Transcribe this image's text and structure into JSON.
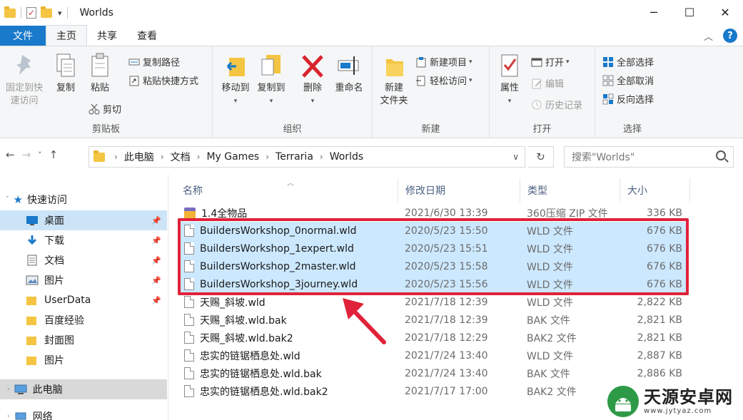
{
  "window": {
    "title": "Worlds",
    "minimize": "─",
    "maximize": "☐",
    "close": "✕"
  },
  "tabs": [
    {
      "label": "文件"
    },
    {
      "label": "主页"
    },
    {
      "label": "共享"
    },
    {
      "label": "查看"
    }
  ],
  "ribbon": {
    "clipboard": {
      "label": "剪贴板",
      "pin_quick_line1": "固定到快",
      "pin_quick_line2": "速访问",
      "copy": "复制",
      "paste": "粘贴",
      "copy_path": "复制路径",
      "paste_shortcut": "粘贴快捷方式",
      "cut": "剪切"
    },
    "organize": {
      "label": "组织",
      "move_to": "移动到",
      "copy_to": "复制到",
      "delete": "删除",
      "rename": "重命名"
    },
    "new": {
      "label": "新建",
      "new_folder_line1": "新建",
      "new_folder_line2": "文件夹",
      "new_item": "新建项目",
      "easy_access": "轻松访问"
    },
    "open": {
      "label": "打开",
      "properties": "属性",
      "open": "打开",
      "edit": "编辑",
      "history": "历史记录"
    },
    "select": {
      "label": "选择",
      "select_all": "全部选择",
      "select_none": "全部取消",
      "invert": "反向选择"
    }
  },
  "address": {
    "crumbs": [
      "此电脑",
      "文档",
      "My Games",
      "Terraria",
      "Worlds"
    ],
    "search_placeholder": "搜索\"Worlds\""
  },
  "sidebar": {
    "quick_access": "快速访问",
    "items": [
      {
        "label": "桌面"
      },
      {
        "label": "下载"
      },
      {
        "label": "文档"
      },
      {
        "label": "图片"
      },
      {
        "label": "UserData"
      },
      {
        "label": "百度经验"
      },
      {
        "label": "封面图"
      },
      {
        "label": "图片"
      }
    ],
    "this_pc": "此电脑",
    "network": "网络"
  },
  "columns": {
    "name": "名称",
    "date": "修改日期",
    "type": "类型",
    "size": "大小"
  },
  "files": [
    {
      "name": "1.4全物品",
      "date": "2021/6/30 13:39",
      "type": "360压缩 ZIP 文件",
      "size": "336 KB"
    },
    {
      "name": "BuildersWorkshop_0normal.wld",
      "date": "2020/5/23 15:50",
      "type": "WLD 文件",
      "size": "676 KB"
    },
    {
      "name": "BuildersWorkshop_1expert.wld",
      "date": "2020/5/23 15:51",
      "type": "WLD 文件",
      "size": "676 KB"
    },
    {
      "name": "BuildersWorkshop_2master.wld",
      "date": "2020/5/23 15:58",
      "type": "WLD 文件",
      "size": "676 KB"
    },
    {
      "name": "BuildersWorkshop_3journey.wld",
      "date": "2020/5/23 15:56",
      "type": "WLD 文件",
      "size": "676 KB"
    },
    {
      "name": "天赐_斜坡.wld",
      "date": "2021/7/18 12:39",
      "type": "WLD 文件",
      "size": "2,822 KB"
    },
    {
      "name": "天赐_斜坡.wld.bak",
      "date": "2021/7/18 12:39",
      "type": "BAK 文件",
      "size": "2,821 KB"
    },
    {
      "name": "天赐_斜坡.wld.bak2",
      "date": "2021/7/18 12:29",
      "type": "BAK2 文件",
      "size": "2,821 KB"
    },
    {
      "name": "忠实的链锯栖息处.wld",
      "date": "2021/7/24 13:40",
      "type": "WLD 文件",
      "size": "2,887 KB"
    },
    {
      "name": "忠实的链锯栖息处.wld.bak",
      "date": "2021/7/24 13:40",
      "type": "BAK 文件",
      "size": "2,886 KB"
    },
    {
      "name": "忠实的链锯栖息处.wld.bak2",
      "date": "2021/7/17 17:00",
      "type": "BAK2 文件",
      "size": ""
    }
  ],
  "watermark": {
    "name": "天源安卓网",
    "url": "www.jytyaz.com"
  },
  "colors": {
    "accent": "#1979ca",
    "selection": "#cce8ff",
    "highlight": "#e0223a"
  }
}
